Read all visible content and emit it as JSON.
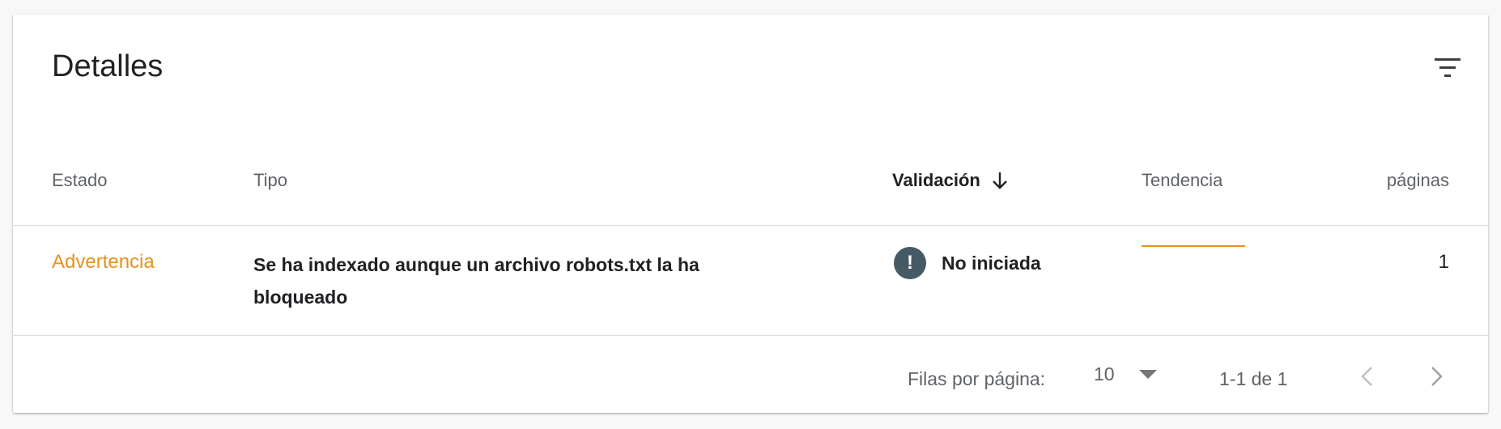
{
  "card": {
    "title": "Detalles",
    "filter_icon": "filter-list-icon"
  },
  "table": {
    "headers": {
      "estado": "Estado",
      "tipo": "Tipo",
      "validacion": "Validación",
      "tendencia": "Tendencia",
      "paginas": "páginas"
    },
    "sort_icon": "arrow-down-icon",
    "rows": [
      {
        "estado": "Advertencia",
        "tipo": "Se ha indexado aunque un archivo robots.txt la ha bloqueado",
        "validacion": "No iniciada",
        "validacion_icon": "exclamation-circle-icon",
        "validacion_icon_glyph": "!",
        "paginas": "1"
      }
    ]
  },
  "pagination": {
    "rows_label": "Filas por página:",
    "rows_value": "10",
    "range": "1-1 de 1",
    "prev_icon": "chevron-left-icon",
    "next_icon": "chevron-right-icon"
  },
  "colors": {
    "warning": "#e8911b",
    "icon_dark": "#455a64",
    "text_primary": "#202124",
    "text_secondary": "#5f6368"
  }
}
